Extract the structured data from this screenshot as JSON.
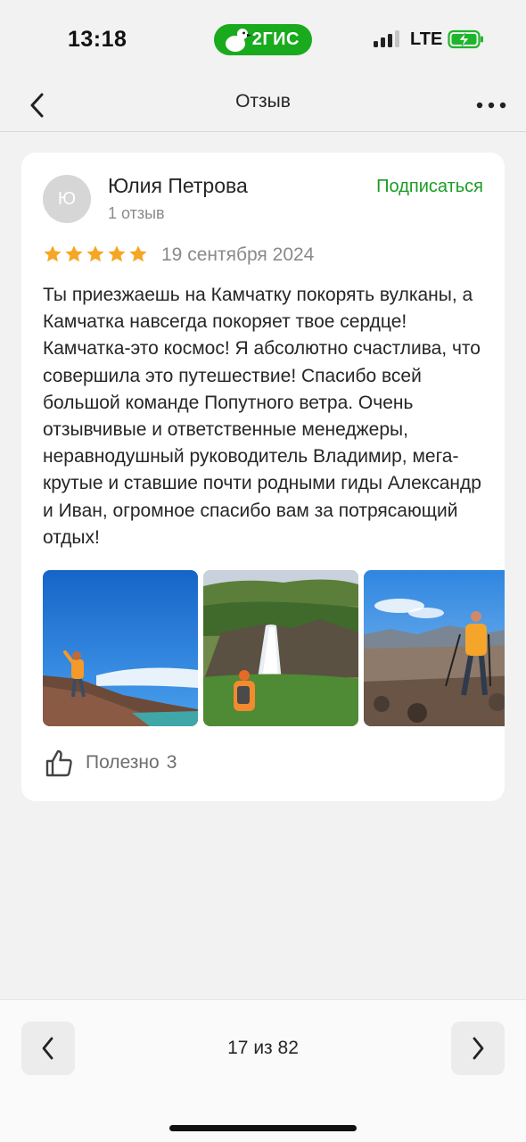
{
  "status_bar": {
    "time": "13:18",
    "brand": "2ГИС",
    "network": "LTE",
    "battery_state": "charging"
  },
  "nav": {
    "title": "Отзыв",
    "back_icon": "chevron-left-icon",
    "more_icon": "more-horizontal-icon"
  },
  "review": {
    "avatar_letter": "Ю",
    "author_name": "Юлия Петрова",
    "author_reviews": "1 отзыв",
    "subscribe_label": "Подписаться",
    "rating": 5,
    "rating_max": 5,
    "date": "19 сентября 2024",
    "text": "Ты приезжаешь на Камчатку покорять вулканы, а Камчатка навсегда покоряет твое сердце! Камчатка-это космос! Я абсолютно счастлива, что совершила это путешествие! Спасибо всей большой команде Попутного ветра. Очень отзывчивые и ответственные менеджеры, неравнодушный руководитель Владимир, мега-крутые и ставшие почти родными гиды Александр и Иван, огромное спасибо вам за потрясающий отдых!",
    "photos": [
      {
        "subject": "hiker-on-crater-rim-photo"
      },
      {
        "subject": "waterfall-hiker-photo"
      },
      {
        "subject": "hiker-with-poles-photo"
      }
    ],
    "helpful_label": "Полезно",
    "helpful_count": "3"
  },
  "pager": {
    "text": "17 из 82"
  },
  "colors": {
    "brand_green": "#19aa1e",
    "subscribe_green": "#1a9c24",
    "star_yellow": "#f5a623",
    "background": "#f2f2f2"
  }
}
